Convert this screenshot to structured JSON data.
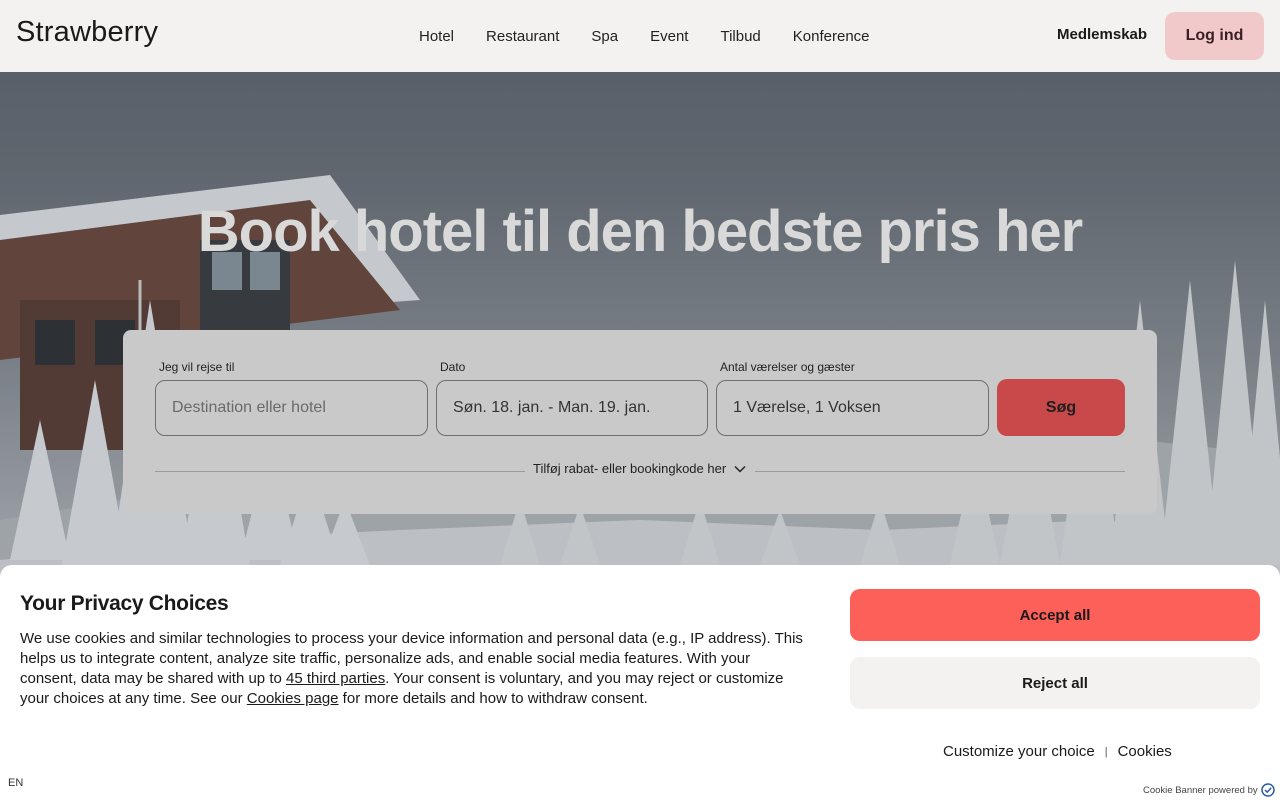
{
  "header": {
    "logo": "Strawberry",
    "nav": [
      "Hotel",
      "Restaurant",
      "Spa",
      "Event",
      "Tilbud",
      "Konference"
    ],
    "member_label": "Medlemskab",
    "login_label": "Log ind"
  },
  "hero": {
    "headline": "Book hotel til den bedste pris her"
  },
  "booking": {
    "destination_label": "Jeg vil rejse til",
    "destination_placeholder": "Destination eller hotel",
    "date_label": "Dato",
    "date_value": "Søn. 18. jan. - Man. 19. jan.",
    "guests_label": "Antal værelser og gæster",
    "guests_value": "1 Værelse, 1 Voksen",
    "search_label": "Søg",
    "code_toggle_label": "Tilføj rabat- eller bookingkode her"
  },
  "cookie": {
    "title": "Your Privacy Choices",
    "text_1": "We use cookies and similar technologies to process your device information and personal data (e.g., IP address). This helps us to integrate content, analyze site traffic, personalize ads, and enable social media features. With your consent, data may be shared with up to ",
    "third_parties_link": "45 third parties",
    "text_2": ". Your consent is voluntary, and you may reject or customize your choices at any time. See our ",
    "cookies_page_link": "Cookies page",
    "text_3": " for more details and how to withdraw consent.",
    "accept_label": "Accept all",
    "reject_label": "Reject all",
    "customize_label": "Customize your choice",
    "separator": "|",
    "cookies_label": "Cookies",
    "language": "EN",
    "powered_by": "Cookie Banner powered by"
  },
  "colors": {
    "accept": "#fd5f59",
    "login": "#f2c9cb",
    "search": "#c9494a",
    "header_bg": "#f3f2f0"
  }
}
